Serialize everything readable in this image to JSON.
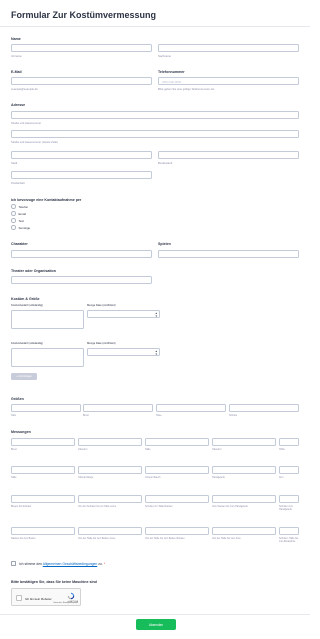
{
  "form": {
    "title": "Formular Zur Kostümvermessung",
    "submit_label": "Absenden"
  },
  "name": {
    "label": "Name",
    "first_sub": "Vorname",
    "last_sub": "Nachname"
  },
  "email": {
    "label": "E-Mail",
    "sub": "example@example.de"
  },
  "phone": {
    "label": "Telefonnummer",
    "placeholder": "(000) 000-0000",
    "sub": "Bitte geben Sie eine gültige Telefonnummer ein."
  },
  "address": {
    "label": "Adresse",
    "street_sub": "Straße und Hausnummer",
    "street2_sub": "Straße und Hausnummer (zweite Zeile)",
    "city_sub": "Stadt",
    "state_sub": "Bundesland",
    "zip_sub": "Postleitzahl"
  },
  "contact": {
    "label": "Ich bevorzuge eine Kontaktaufnahme per",
    "options": [
      "Telefon",
      "Email",
      "Text",
      "Sonstige"
    ]
  },
  "character": {
    "label": "Charakter"
  },
  "play": {
    "label": "Spielen"
  },
  "theater": {
    "label": "Theater oder Organisation"
  },
  "costumes": {
    "label": "Kostüm & Größe",
    "desc_label": "Kostümbedarf (vollständig)",
    "date_label": "Menge Date (zertifiziert)",
    "add_label": "+ Hinzufügen"
  },
  "sizes": {
    "label": "Größen",
    "subs": [
      "Hals",
      "Brust",
      "Hose",
      "Schuhe"
    ]
  },
  "measurements": {
    "label": "Messungen",
    "row1": [
      "Brust",
      "Oberarm",
      "Taille",
      "Oberarm",
      "Hüfte"
    ],
    "row2": [
      "Taille",
      "Oberarmlänge",
      "Unterer Bauch",
      "Handgelenk",
      "Arm"
    ],
    "row3": [
      "Bizeps bis Schulter",
      "Um den Schulter bis zur Taille vorne",
      "Schulter zur Taille Rücken",
      "Vom Nacken bis zum Handgelenk",
      "Schulter zum Handgelenk"
    ],
    "row4": [
      "Nacken bis zum Boden",
      "Von der Taille bis zum Boden vorne",
      "Von der Taille bis zum Boden Rücken",
      "Von der Taille bis zum Knie",
      "Schulter: Taille bis zum Bodenlinie"
    ]
  },
  "consent": {
    "prefix": "Ich stimme den",
    "link": "Allgemeinen Geschäftsbedingungen",
    "suffix": "zu."
  },
  "captcha": {
    "label": "Bitte bestätigen Sie, dass Sie keine Maschine sind",
    "text": "Ich bin kein Roboter",
    "brand": "reCAPTCHA",
    "terms": "Datenschutz - Nutzungsbedingungen"
  },
  "colors": {
    "submit": "#18bd5b",
    "link": "#0066c3",
    "required": "#f23a3c"
  }
}
